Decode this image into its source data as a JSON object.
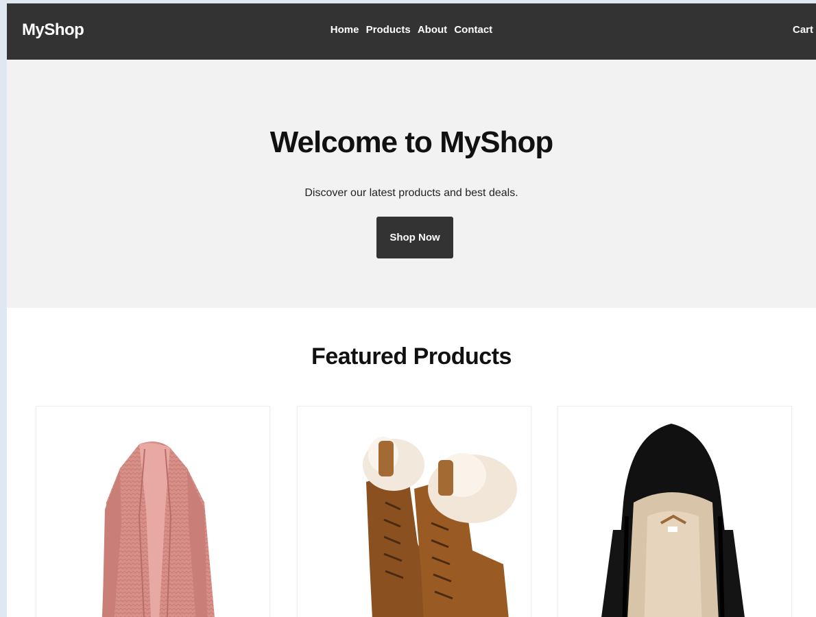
{
  "header": {
    "logo": "MyShop",
    "nav": [
      {
        "label": "Home"
      },
      {
        "label": "Products"
      },
      {
        "label": "About"
      },
      {
        "label": "Contact"
      }
    ],
    "cart_label": "Cart"
  },
  "hero": {
    "title": "Welcome to MyShop",
    "subtitle": "Discover our latest products and best deals.",
    "button_label": "Shop Now"
  },
  "featured": {
    "title": "Featured Products",
    "products": [
      {
        "image": "pink-cardigan-image",
        "color": "#d9908a"
      },
      {
        "image": "fur-lined-boots-image",
        "color": "#8a5020"
      },
      {
        "image": "sherpa-hoodie-image",
        "color": "#111111"
      }
    ]
  },
  "colors": {
    "header_bg": "#333333",
    "hero_bg": "#f2f2f2",
    "button_bg": "#333333"
  }
}
